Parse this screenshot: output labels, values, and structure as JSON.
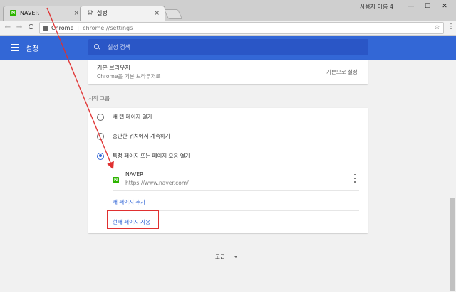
{
  "window": {
    "user_label": "사용자 이름 4",
    "minimize_glyph": "—",
    "maximize_glyph": "☐",
    "close_glyph": "✕"
  },
  "tabs": [
    {
      "title": "NAVER",
      "icon": "naver-icon",
      "icon_letter": "N",
      "close": "×"
    },
    {
      "title": "설정",
      "icon": "gear-icon",
      "icon_glyph": "⚙",
      "close": "×"
    }
  ],
  "toolbar": {
    "back_glyph": "←",
    "forward_glyph": "→",
    "reload_glyph": "C",
    "origin_label": "Chrome",
    "separator": "|",
    "url": "chrome://settings",
    "star_glyph": "☆",
    "menu_glyph": "⋮"
  },
  "header": {
    "title": "설정",
    "search_placeholder": "설정 검색"
  },
  "default_browser": {
    "title": "기본 브라우저",
    "subtitle": "Chrome을 기본 브라우저로",
    "button": "기본으로 설정"
  },
  "startup": {
    "section_title": "시작 그룹",
    "options": [
      {
        "label": "새 탭 페이지 열기",
        "checked": false
      },
      {
        "label": "중단한 위치에서 계속하기",
        "checked": false
      },
      {
        "label": "특정 페이지 또는 페이지 모음 열기",
        "checked": true
      }
    ],
    "pages": [
      {
        "name": "NAVER",
        "url": "https://www.naver.com/",
        "icon_letter": "N"
      }
    ],
    "add_page": "새 페이지 추가",
    "use_current": "현재 페이지 사용"
  },
  "advanced": {
    "label": "고급"
  },
  "colors": {
    "header_blue": "#3367d6",
    "naver_green": "#2db400",
    "annotation_red": "#e03030"
  }
}
